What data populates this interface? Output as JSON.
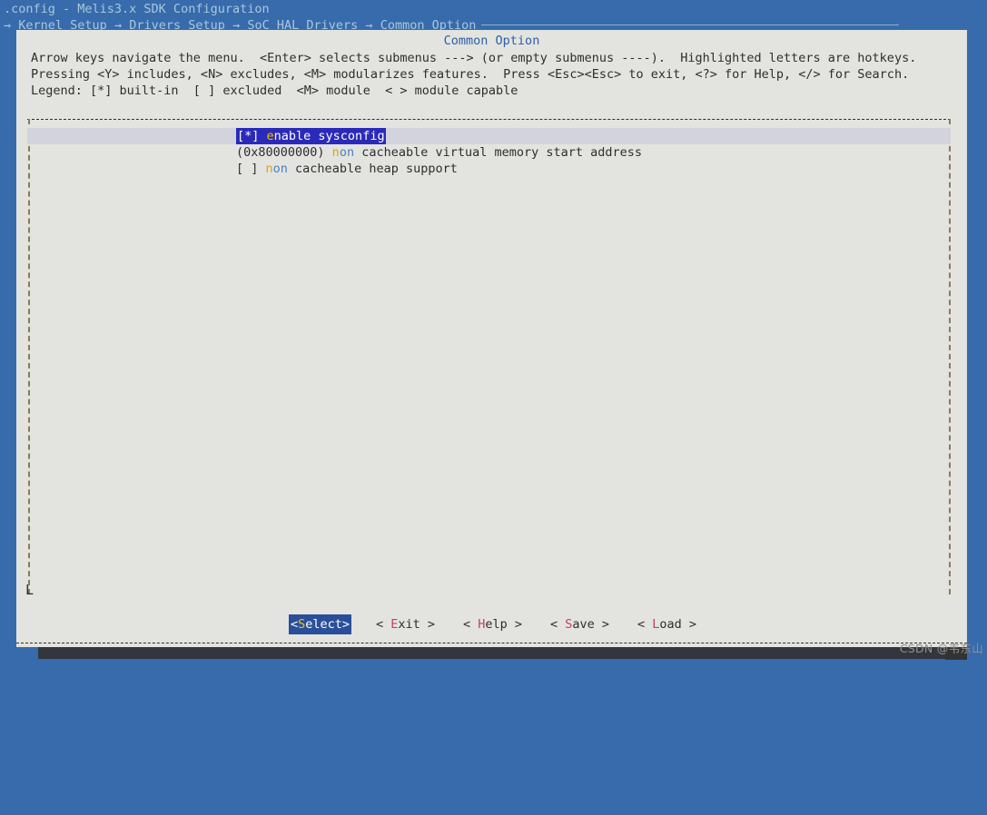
{
  "header": {
    "title": ".config - Melis3.x SDK Configuration",
    "breadcrumb": [
      "Kernel Setup",
      "Drivers Setup",
      "SoC HAL Drivers",
      "Common Option"
    ],
    "breadcrumb_separator": "→"
  },
  "dialog": {
    "title": "Common Option",
    "help_lines": [
      "Arrow keys navigate the menu.  <Enter> selects submenus ---> (or empty submenus ----).  Highlighted letters are hotkeys.",
      "Pressing <Y> includes, <N> excludes, <M> modularizes features.  Press <Esc><Esc> to exit, <?> for Help, </> for Search.",
      "Legend: [*] built-in  [ ] excluded  <M> module  < > module capable"
    ]
  },
  "menu": {
    "items": [
      {
        "prefix": "[*] ",
        "hotkey": "e",
        "hotkey_color": "yellow",
        "rest": "nable sysconfig",
        "selected": true,
        "full_text": "[*] enable sysconfig"
      },
      {
        "prefix": "(0x80000000) ",
        "hotkey": "n",
        "hotkey_color": "yellow",
        "blue_part": "on",
        "rest": " cacheable virtual memory start address",
        "selected": false,
        "full_text": "(0x80000000) non cacheable virtual memory start address"
      },
      {
        "prefix": "[ ] ",
        "hotkey": "n",
        "hotkey_color": "yellow",
        "blue_part": "on",
        "rest": " cacheable heap support",
        "selected": false,
        "full_text": "[ ] non cacheable heap support"
      }
    ]
  },
  "buttons": [
    {
      "open": "<",
      "hotkey": "S",
      "label_rest": "elect",
      "close": ">",
      "active": true,
      "text": "<Select>"
    },
    {
      "open": "< ",
      "hotkey": "E",
      "label_rest": "xit",
      "close": " >",
      "active": false,
      "text": "< Exit >"
    },
    {
      "open": "< ",
      "hotkey": "H",
      "label_rest": "elp",
      "close": " >",
      "active": false,
      "text": "< Help >"
    },
    {
      "open": "< ",
      "hotkey": "S",
      "label_rest": "ave",
      "close": " >",
      "active": false,
      "text": "< Save >"
    },
    {
      "open": "< ",
      "hotkey": "L",
      "label_rest": "oad",
      "close": " >",
      "active": false,
      "text": "< Load >"
    }
  ],
  "watermark": "CSDN @韦东山",
  "colors": {
    "terminal_blue": "#376bab",
    "dialog_bg": "#e3e4df",
    "title_blue": "#2b5fa8",
    "selection_blue": "#2a2aba",
    "selection_band": "#d3d3de",
    "hotkey_yellow": "#e0a400",
    "hotkey_pink": "#c83a72",
    "text_blue": "#4a7fc1",
    "text_dark": "#2e2e2e",
    "header_text": "#a9c7dd"
  }
}
